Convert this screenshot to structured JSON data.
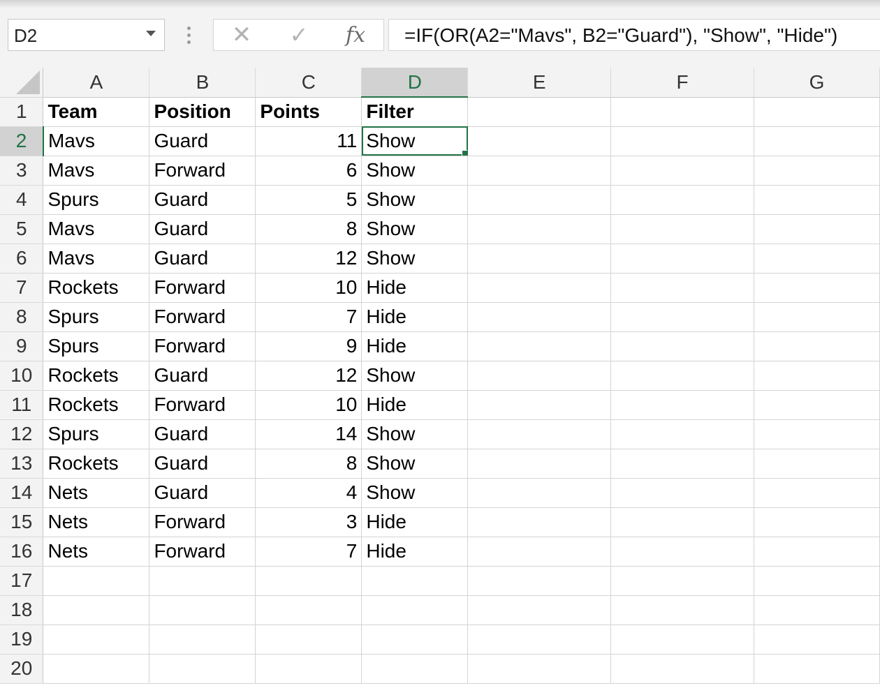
{
  "name_box": {
    "value": "D2"
  },
  "formula_bar": {
    "cancel_icon": "cancel-x-icon",
    "enter_icon": "checkmark-icon",
    "fx_label": "fx",
    "formula": "=IF(OR(A2=\"Mavs\", B2=\"Guard\"), \"Show\", \"Hide\")"
  },
  "selected_cell": "D2",
  "colors": {
    "accent": "#217346",
    "header_bg": "#f3f3f3",
    "selected_header_bg": "#d2d2d2",
    "gridline": "#d4d4d4"
  },
  "columns": [
    "A",
    "B",
    "C",
    "D",
    "E",
    "F",
    "G"
  ],
  "rows": [
    {
      "n": "1",
      "a": "Team",
      "b": "Position",
      "c": "Points",
      "d": "Filter"
    },
    {
      "n": "2",
      "a": "Mavs",
      "b": "Guard",
      "c": "11",
      "d": "Show"
    },
    {
      "n": "3",
      "a": "Mavs",
      "b": "Forward",
      "c": "6",
      "d": "Show"
    },
    {
      "n": "4",
      "a": "Spurs",
      "b": "Guard",
      "c": "5",
      "d": "Show"
    },
    {
      "n": "5",
      "a": "Mavs",
      "b": "Guard",
      "c": "8",
      "d": "Show"
    },
    {
      "n": "6",
      "a": "Mavs",
      "b": "Guard",
      "c": "12",
      "d": "Show"
    },
    {
      "n": "7",
      "a": "Rockets",
      "b": "Forward",
      "c": "10",
      "d": "Hide"
    },
    {
      "n": "8",
      "a": "Spurs",
      "b": "Forward",
      "c": "7",
      "d": "Hide"
    },
    {
      "n": "9",
      "a": "Spurs",
      "b": "Forward",
      "c": "9",
      "d": "Hide"
    },
    {
      "n": "10",
      "a": "Rockets",
      "b": "Guard",
      "c": "12",
      "d": "Show"
    },
    {
      "n": "11",
      "a": "Rockets",
      "b": "Forward",
      "c": "10",
      "d": "Hide"
    },
    {
      "n": "12",
      "a": "Spurs",
      "b": "Guard",
      "c": "14",
      "d": "Show"
    },
    {
      "n": "13",
      "a": "Rockets",
      "b": "Guard",
      "c": "8",
      "d": "Show"
    },
    {
      "n": "14",
      "a": "Nets",
      "b": "Guard",
      "c": "4",
      "d": "Show"
    },
    {
      "n": "15",
      "a": "Nets",
      "b": "Forward",
      "c": "3",
      "d": "Hide"
    },
    {
      "n": "16",
      "a": "Nets",
      "b": "Forward",
      "c": "7",
      "d": "Hide"
    },
    {
      "n": "17",
      "a": "",
      "b": "",
      "c": "",
      "d": ""
    },
    {
      "n": "18",
      "a": "",
      "b": "",
      "c": "",
      "d": ""
    },
    {
      "n": "19",
      "a": "",
      "b": "",
      "c": "",
      "d": ""
    },
    {
      "n": "20",
      "a": "",
      "b": "",
      "c": "",
      "d": ""
    }
  ]
}
